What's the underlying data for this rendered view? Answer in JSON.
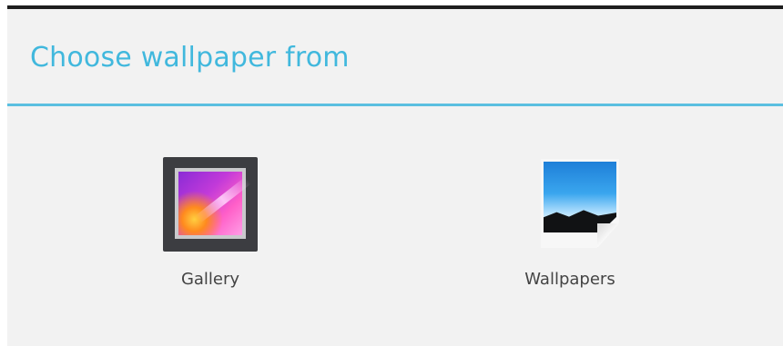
{
  "dialog": {
    "title": "Choose wallpaper from",
    "accent_color": "#41b8dd",
    "options": [
      {
        "label": "Gallery",
        "icon": "gallery-icon"
      },
      {
        "label": "Wallpapers",
        "icon": "wallpapers-icon"
      }
    ]
  }
}
